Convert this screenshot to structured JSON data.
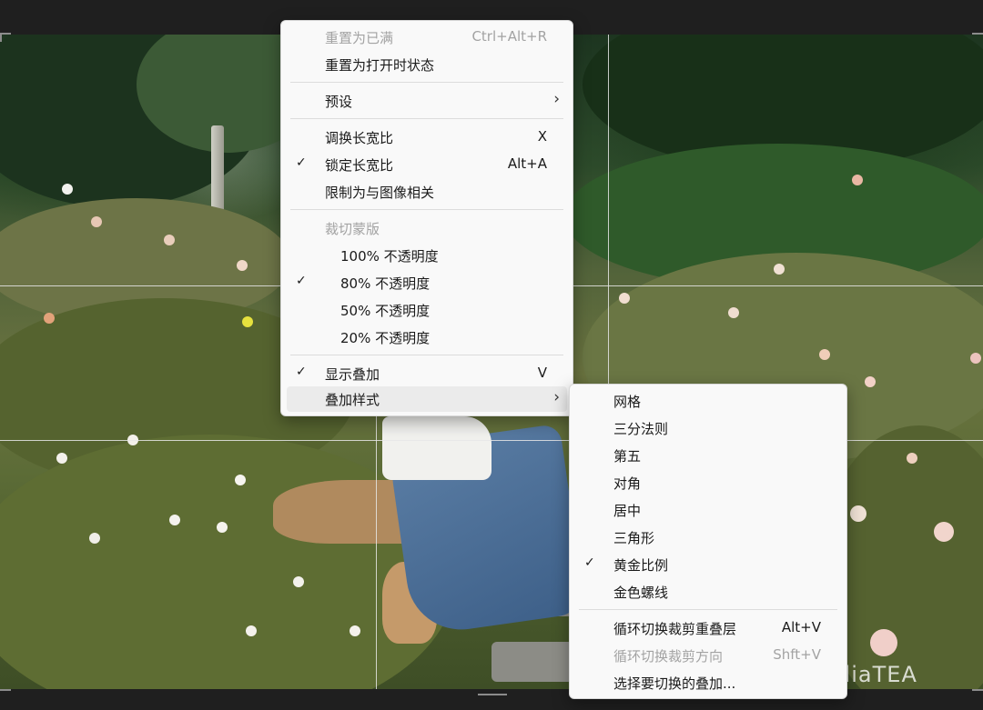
{
  "main_menu": {
    "reset_full": {
      "label": "重置为已满",
      "shortcut": "Ctrl+Alt+R"
    },
    "reset_open": {
      "label": "重置为打开时状态"
    },
    "preset": {
      "label": "预设"
    },
    "swap_ratio": {
      "label": "调换长宽比",
      "shortcut": "X"
    },
    "lock_ratio": {
      "label": "锁定长宽比",
      "shortcut": "Alt+A",
      "checked": true
    },
    "constrain_image": {
      "label": "限制为与图像相关"
    },
    "crop_mask_header": "裁切蒙版",
    "opacity_100": {
      "label": "100% 不透明度"
    },
    "opacity_80": {
      "label": "80% 不透明度",
      "checked": true
    },
    "opacity_50": {
      "label": "50% 不透明度"
    },
    "opacity_20": {
      "label": "20% 不透明度"
    },
    "show_overlay": {
      "label": "显示叠加",
      "shortcut": "V",
      "checked": true
    },
    "overlay_style": {
      "label": "叠加样式"
    }
  },
  "submenu": {
    "grid": {
      "label": "网格"
    },
    "thirds": {
      "label": "三分法则"
    },
    "fifth": {
      "label": "第五"
    },
    "diagonal": {
      "label": "对角"
    },
    "center": {
      "label": "居中"
    },
    "triangle": {
      "label": "三角形"
    },
    "golden_ratio": {
      "label": "黄金比例",
      "checked": true
    },
    "golden_spiral": {
      "label": "金色螺线"
    },
    "cycle_overlay": {
      "label": "循环切换裁剪重叠层",
      "shortcut": "Alt+V"
    },
    "cycle_direction": {
      "label": "循环切换裁剪方向",
      "shortcut": "Shft+V"
    },
    "choose_overlay": {
      "label": "选择要切换的叠加..."
    }
  },
  "watermark": {
    "text": "公众号 · mediaTEA"
  },
  "icons": {
    "check": "checkmark-icon",
    "submenu": "chevron-right-icon",
    "watermark": "wechat-icon"
  }
}
